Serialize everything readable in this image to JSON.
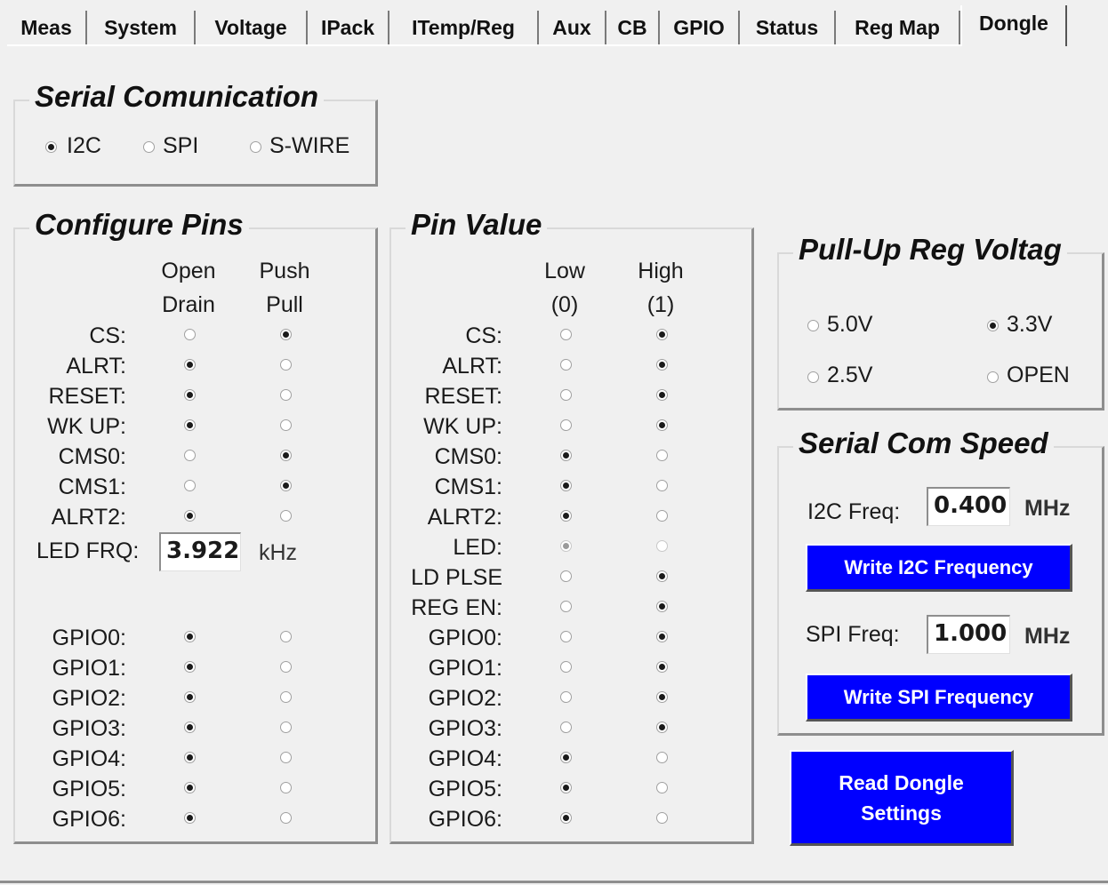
{
  "tabs": [
    "Meas",
    "System",
    "Voltage",
    "IPack",
    "ITemp/Reg",
    "Aux",
    "CB",
    "GPIO",
    "Status",
    "Reg Map",
    "Dongle"
  ],
  "serial": {
    "title": "Serial  Comunication",
    "options": [
      "I2C",
      "SPI",
      "S-WIRE"
    ],
    "selected": "I2C"
  },
  "configure": {
    "title": "Configure Pins",
    "hdr1a": "Open",
    "hdr1b": "Drain",
    "hdr2a": "Push",
    "hdr2b": "Pull",
    "pins": [
      {
        "label": "CS:",
        "value": "push_pull"
      },
      {
        "label": "ALRT:",
        "value": "open_drain"
      },
      {
        "label": "RESET:",
        "value": "open_drain"
      },
      {
        "label": "WK UP:",
        "value": "open_drain"
      },
      {
        "label": "CMS0:",
        "value": "push_pull"
      },
      {
        "label": "CMS1:",
        "value": "push_pull"
      },
      {
        "label": "ALRT2:",
        "value": "open_drain"
      }
    ],
    "led_label": "LED FRQ:",
    "led_value": "3.922",
    "led_unit": "kHz",
    "gpio": [
      {
        "label": "GPIO0:",
        "value": "open_drain"
      },
      {
        "label": "GPIO1:",
        "value": "open_drain"
      },
      {
        "label": "GPIO2:",
        "value": "open_drain"
      },
      {
        "label": "GPIO3:",
        "value": "open_drain"
      },
      {
        "label": "GPIO4:",
        "value": "open_drain"
      },
      {
        "label": "GPIO5:",
        "value": "open_drain"
      },
      {
        "label": "GPIO6:",
        "value": "open_drain"
      }
    ]
  },
  "pinvalue": {
    "title": "Pin Value",
    "hdr1a": "Low",
    "hdr1b": "(0)",
    "hdr2a": "High",
    "hdr2b": "(1)",
    "pins": [
      {
        "label": "CS:",
        "value": "high"
      },
      {
        "label": "ALRT:",
        "value": "high"
      },
      {
        "label": "RESET:",
        "value": "high"
      },
      {
        "label": "WK UP:",
        "value": "high"
      },
      {
        "label": "CMS0:",
        "value": "low"
      },
      {
        "label": "CMS1:",
        "value": "low"
      },
      {
        "label": "ALRT2:",
        "value": "low"
      },
      {
        "label": "LED:",
        "value": "low",
        "disabled": true
      },
      {
        "label": "LD PLSE",
        "value": "high"
      },
      {
        "label": "REG EN:",
        "value": "high"
      },
      {
        "label": "GPIO0:",
        "value": "high"
      },
      {
        "label": "GPIO1:",
        "value": "high"
      },
      {
        "label": "GPIO2:",
        "value": "high"
      },
      {
        "label": "GPIO3:",
        "value": "high"
      },
      {
        "label": "GPIO4:",
        "value": "low"
      },
      {
        "label": "GPIO5:",
        "value": "low"
      },
      {
        "label": "GPIO6:",
        "value": "low"
      }
    ]
  },
  "pullup": {
    "title": "Pull-Up Reg Voltag",
    "options": [
      "5.0V",
      "3.3V",
      "2.5V",
      "OPEN"
    ],
    "selected": "3.3V"
  },
  "speed": {
    "title": "Serial Com Speed",
    "i2c_label": "I2C Freq:",
    "i2c_value": "0.400",
    "i2c_unit": "MHz",
    "i2c_button": "Write I2C Frequency",
    "spi_label": "SPI Freq:",
    "spi_value": "1.000",
    "spi_unit": "MHz",
    "spi_button": "Write SPI Frequency"
  },
  "read_button_line1": "Read Dongle",
  "read_button_line2": "Settings",
  "colors": {
    "button": "#0000ff",
    "background": "#f0f0f0"
  }
}
